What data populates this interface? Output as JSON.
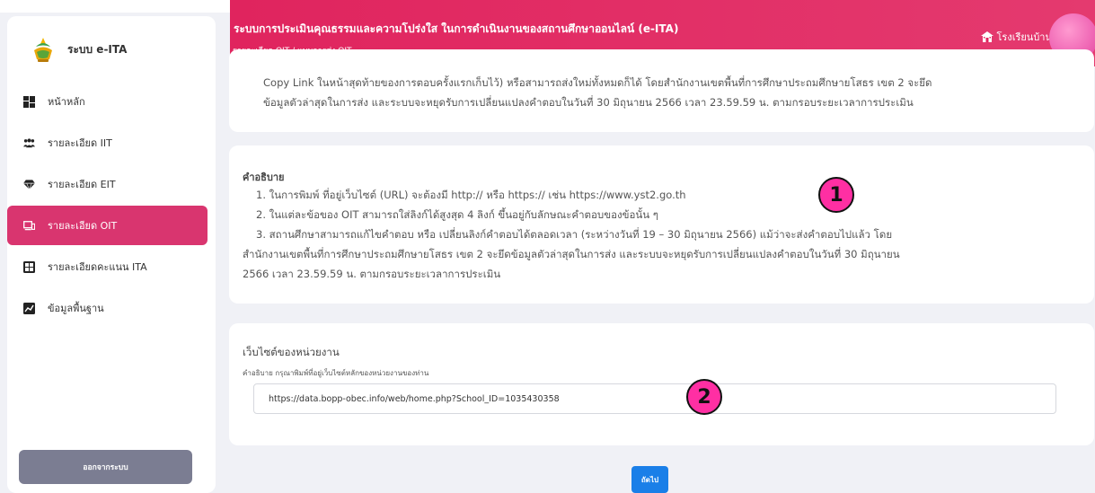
{
  "sidebar": {
    "brand_title": "ระบบ e-ITA",
    "items": [
      {
        "label": "หน้าหลัก",
        "icon": "dashboard-icon"
      },
      {
        "label": "รายละเอียด IIT",
        "icon": "users-icon"
      },
      {
        "label": "รายละเอียด EIT",
        "icon": "gem-icon"
      },
      {
        "label": "รายละเอียด OIT",
        "icon": "monitor-icon",
        "active": true
      },
      {
        "label": "รายละเอียดคะแนน ITA",
        "icon": "table-icon"
      },
      {
        "label": "ข้อมูลพื้นฐาน",
        "icon": "chart-icon"
      }
    ],
    "logout_label": "ออกจากระบบ"
  },
  "header": {
    "title": "ระบบการประเมินคุณธรรมและความโปร่งใส ในการดำเนินงานของสถานศึกษาออนไลน์ (e-ITA)",
    "breadcrumb": "รายละเอียด OIT / แบบการส่ง OIT",
    "school": "โรงเรียนบ้าน"
  },
  "card1": {
    "line1": "Copy Link ในหน้าสุดท้ายของการตอบครั้งแรกเก็บไว้) หรือสามารถส่งใหม่ทั้งหมดก็ได้ โดยสำนักงานเขตพื้นที่การศึกษาประถมศึกษายโสธร เขต 2 จะยึด",
    "line2": "ข้อมูลตัวล่าสุดในการส่ง และระบบจะหยุดรับการเปลี่ยนแปลงคำตอบในวันที่ 30 มิถุนายน 2566 เวลา 23.59.59 น. ตามกรอบระยะเวลาการประเมิน"
  },
  "card2": {
    "title": "คำอธิบาย",
    "items": [
      "1. ในการพิมพ์ ที่อยู่เว็บไซต์ (URL) จะต้องมี http:// หรือ https:// เช่น https://www.yst2.go.th",
      "2. ในแต่ละข้อของ OIT สามารถใส่ลิงก์ได้สูงสุด 4 ลิงก์ ขึ้นอยู่กับลักษณะคำตอบของข้อนั้น ๆ",
      "3. สถานศึกษาสามารถแก้ไขคำตอบ หรือ เปลี่ยนลิงก์คำตอบได้ตลอดเวลา (ระหว่างวันที่ 19 – 30 มิถุนายน 2566) แม้ว่าจะส่งคำตอบไปแล้ว โดย",
      "สำนักงานเขตพื้นที่การศึกษาประถมศึกษายโสธร เขต 2 จะยึดข้อมูลตัวล่าสุดในการส่ง และระบบจะหยุดรับการเปลี่ยนแปลงคำตอบในวันที่ 30 มิถุนายน",
      "2566 เวลา 23.59.59 น. ตามกรอบระยะเวลาการประเมิน"
    ]
  },
  "card3": {
    "title": "เว็บไซต์ของหน่วยงาน",
    "description": "คำอธิบาย กรุณาพิมพ์ที่อยู่เว็บไซต์หลักของหน่วยงานของท่าน",
    "url_value": "https://data.bopp-obec.info/web/home.php?School_ID=1035430358"
  },
  "next_label": "ถัดไป",
  "markers": [
    "1",
    "2"
  ],
  "colors": {
    "accent": "#e0245e",
    "button": "#1a7fe8",
    "logout": "#7b7d92",
    "marker": "#ff2fa3"
  }
}
